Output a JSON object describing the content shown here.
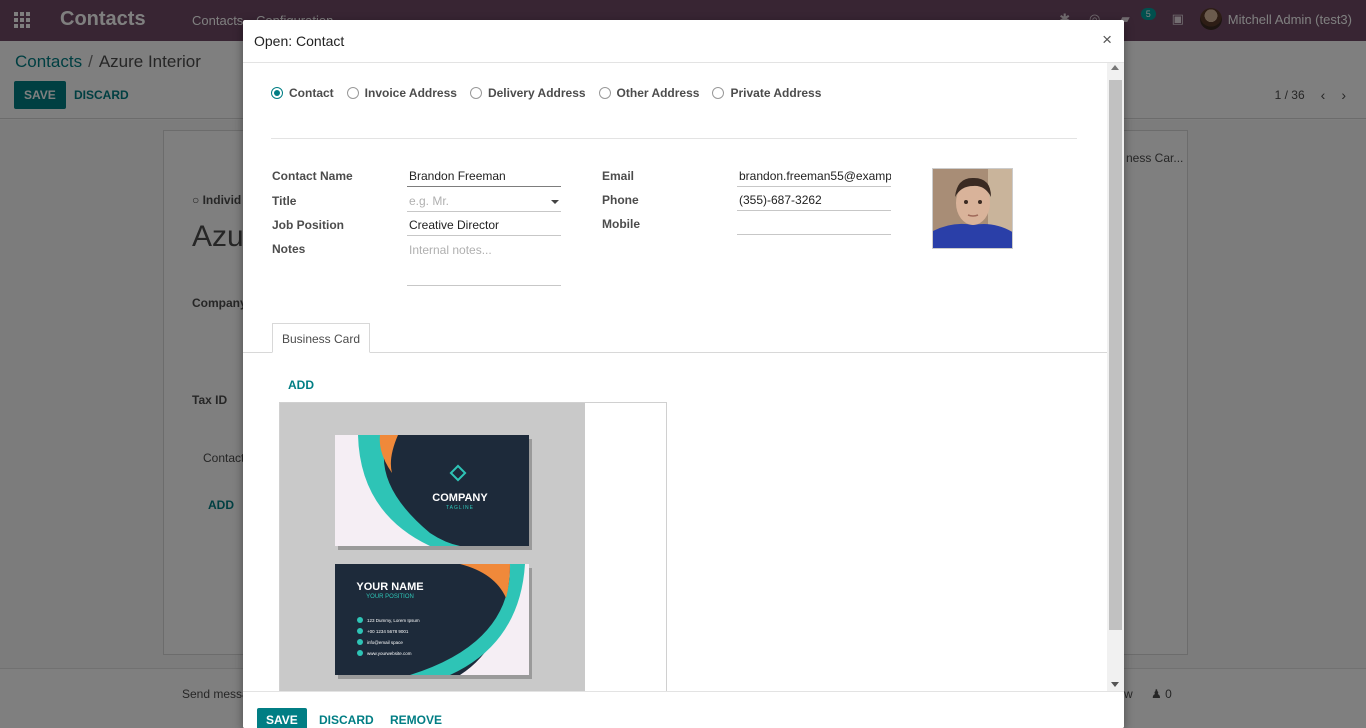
{
  "navbar": {
    "brand": "Contacts",
    "menu": [
      "Contacts",
      "Configuration"
    ],
    "messages_count": "5",
    "user_name": "Mitchell Admin (test3)"
  },
  "control": {
    "breadcrumb_parent": "Contacts",
    "breadcrumb_current": "Azure Interior",
    "save_label": "SAVE",
    "discard_label": "DISCARD",
    "pager": "1 / 36"
  },
  "background": {
    "individual_label": "Individ",
    "name_fragment": "Azu",
    "company_label": "Company",
    "tax_id_label": "Tax ID",
    "contacts_tab": "Contact",
    "add_label": "ADD",
    "business_card_tab": "ness Car...",
    "send_message": "Send messa",
    "chatter_tail": "w",
    "followers": "0"
  },
  "modal": {
    "title": "Open: Contact",
    "close": "×",
    "address_types": [
      {
        "label": "Contact",
        "checked": true
      },
      {
        "label": "Invoice Address",
        "checked": false
      },
      {
        "label": "Delivery Address",
        "checked": false
      },
      {
        "label": "Other Address",
        "checked": false
      },
      {
        "label": "Private Address",
        "checked": false
      }
    ],
    "form": {
      "contact_name_label": "Contact Name",
      "contact_name": "Brandon Freeman",
      "title_label": "Title",
      "title_placeholder": "e.g. Mr.",
      "job_position_label": "Job Position",
      "job_position": "Creative Director",
      "notes_label": "Notes",
      "notes_placeholder": "Internal notes...",
      "email_label": "Email",
      "email": "brandon.freeman55@exampl",
      "phone_label": "Phone",
      "phone": "(355)-687-3262",
      "mobile_label": "Mobile",
      "mobile": ""
    },
    "tab_label": "Business Card",
    "add_label": "ADD",
    "business_card": {
      "company": "COMPANY",
      "tagline": "TAGLINE",
      "your_name": "YOUR NAME",
      "your_position": "YOUR POSITION",
      "details": [
        "123 Dummy, Lorem Ipsum",
        "+00 1234 5678 9001",
        "info@email space",
        "www.yourwebsite.com"
      ]
    },
    "footer": {
      "save": "SAVE",
      "discard": "DISCARD",
      "remove": "REMOVE"
    }
  },
  "colors": {
    "navbar": "#714b67",
    "accent": "#017e84"
  }
}
